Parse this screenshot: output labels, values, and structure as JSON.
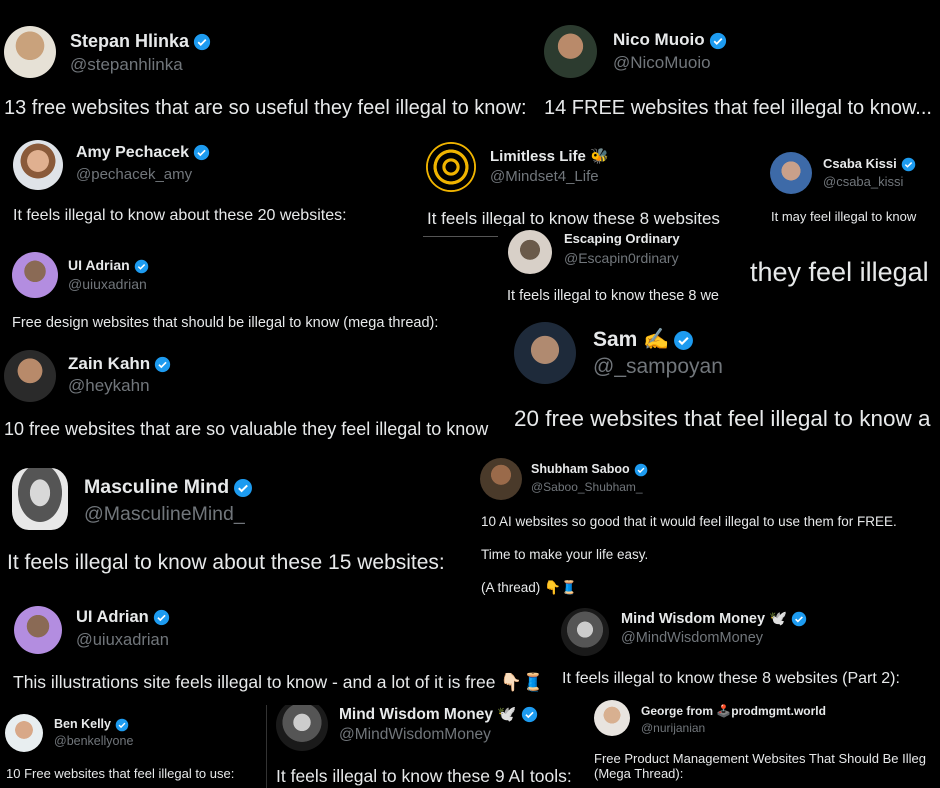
{
  "posts": [
    {
      "name": "Stepan Hlinka",
      "handle": "@stepanhlinka",
      "text": "13 free websites that are so useful they feel illegal to know:"
    },
    {
      "name": "Nico Muoio",
      "handle": "@NicoMuoio",
      "text": "14 FREE websites that feel illegal to know..."
    },
    {
      "name": "Amy Pechacek",
      "handle": "@pechacek_amy",
      "text": "It feels illegal to know about these 20 websites:"
    },
    {
      "name": "Limitless Life 🐝",
      "handle": "@Mindset4_Life",
      "text": "It feels illegal to know these 8 websites"
    },
    {
      "name": "Csaba Kissi",
      "handle": "@csaba_kissi",
      "text": "It may feel illegal to know"
    },
    {
      "name": "UI Adrian",
      "handle": "@uiuxadrian",
      "text": "Free design websites that should be illegal to know (mega thread):"
    },
    {
      "name": "Escaping Ordinary",
      "handle": "@Escapin0rdinary",
      "text": "It feels illegal to know these 8 we"
    },
    {
      "text": "they feel illegal"
    },
    {
      "name": "Zain Kahn",
      "handle": "@heykahn",
      "text": "10 free websites that are so valuable they feel illegal to know"
    },
    {
      "name": "Sam ✍️",
      "handle": "@_sampoyan",
      "text": "20 free websites that feel illegal to know a"
    },
    {
      "name": "Masculine Mind",
      "handle": "@MasculineMind_",
      "text": "It feels illegal to know about these 15 websites:"
    },
    {
      "name": "Shubham Saboo",
      "handle": "@Saboo_Shubham_",
      "text": "10 AI websites so good that it would feel illegal to use them for FREE.",
      "text2": "Time to make your life easy.",
      "text3": "(A thread) 👇🧵"
    },
    {
      "name": "UI Adrian",
      "handle": "@uiuxadrian",
      "text": "This illustrations site feels illegal to know - and a lot of it is free 👇🏻🧵"
    },
    {
      "name": "Mind Wisdom Money 🕊️",
      "handle": "@MindWisdomMoney",
      "text": "It feels illegal to know these 8 websites (Part 2):"
    },
    {
      "name": "Ben Kelly",
      "handle": "@benkellyone",
      "text": "10 Free websites that feel illegal to use:"
    },
    {
      "name": "Mind Wisdom Money 🕊️",
      "handle": "@MindWisdomMoney",
      "text": "It feels illegal to know these 9 AI tools:"
    },
    {
      "name": "George from 🕹️prodmgmt.world",
      "handle": "@nurijanian",
      "text": "Free Product Management Websites That Should Be Illeg",
      "text2": "(Mega Thread):"
    }
  ],
  "colors": {
    "bg": "#000000",
    "text": "#e7e9ea",
    "handle": "#71767b",
    "verified": "#1d9bf0"
  }
}
